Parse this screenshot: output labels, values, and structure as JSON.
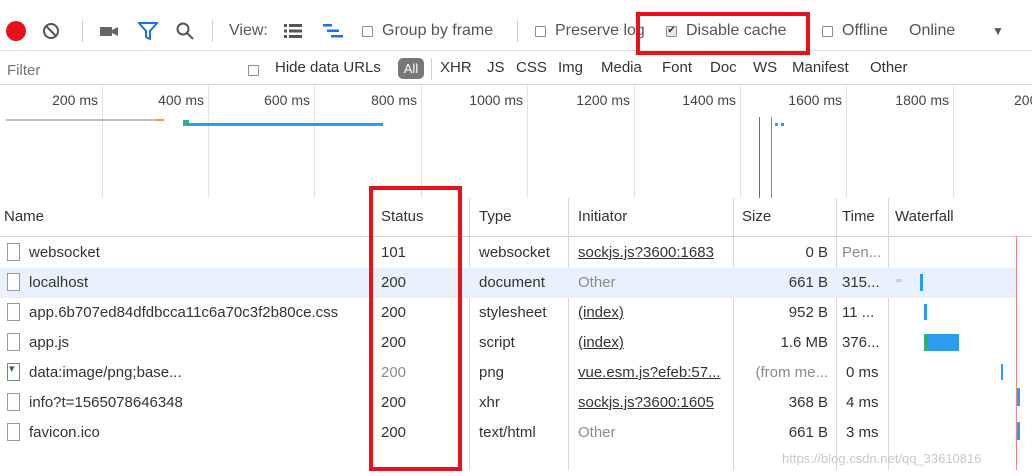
{
  "toolbar": {
    "view_label": "View:",
    "group_by_frame": "Group by frame",
    "preserve_log": "Preserve log",
    "disable_cache": "Disable cache",
    "offline": "Offline",
    "online": "Online",
    "dropdown_glyph": "▼"
  },
  "filters": {
    "placeholder": "Filter",
    "hide_data_urls": "Hide data URLs",
    "all": "All",
    "types": [
      "XHR",
      "JS",
      "CSS",
      "Img",
      "Media",
      "Font",
      "Doc",
      "WS",
      "Manifest",
      "Other"
    ]
  },
  "timeline": {
    "ticks": [
      "200 ms",
      "400 ms",
      "600 ms",
      "800 ms",
      "1000 ms",
      "1200 ms",
      "1400 ms",
      "1600 ms",
      "1800 ms",
      "200"
    ]
  },
  "table": {
    "headers": {
      "name": "Name",
      "status": "Status",
      "type": "Type",
      "initiator": "Initiator",
      "size": "Size",
      "time": "Time",
      "waterfall": "Waterfall"
    },
    "rows": [
      {
        "name": "websocket",
        "status": "101",
        "type": "websocket",
        "initiator": "sockjs.js?3600:1683",
        "size": "0 B",
        "time": "Pen..."
      },
      {
        "name": "localhost",
        "status": "200",
        "type": "document",
        "initiator": "Other",
        "size": "661 B",
        "time": "315..."
      },
      {
        "name": "app.6b707ed84dfdbcca11c6a70c3f2b80ce.css",
        "status": "200",
        "type": "stylesheet",
        "initiator": "(index)",
        "size": "952 B",
        "time": "11 ..."
      },
      {
        "name": "app.js",
        "status": "200",
        "type": "script",
        "initiator": "(index)",
        "size": "1.6 MB",
        "time": "376..."
      },
      {
        "name": "data:image/png;base...",
        "status": "200",
        "type": "png",
        "initiator": "vue.esm.js?efeb:57...",
        "size": "(from me...",
        "time": "0 ms"
      },
      {
        "name": "info?t=1565078646348",
        "status": "200",
        "type": "xhr",
        "initiator": "sockjs.js?3600:1605",
        "size": "368 B",
        "time": "4 ms"
      },
      {
        "name": "favicon.ico",
        "status": "200",
        "type": "text/html",
        "initiator": "Other",
        "size": "661 B",
        "time": "3 ms"
      }
    ]
  },
  "watermark": "https://blog.csdn.net/qq_33610816",
  "colors": {
    "record": "#e8121c",
    "highlight": "#e8121c",
    "accent": "#2b9cf0",
    "selected_row": "#e8f1fd"
  }
}
